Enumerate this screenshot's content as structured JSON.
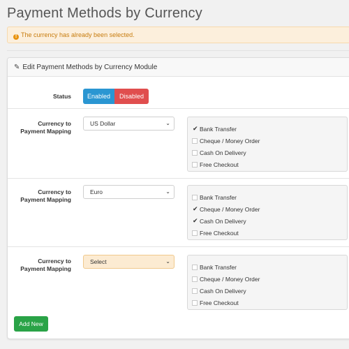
{
  "page": {
    "title": "Payment Methods by Currency"
  },
  "alert": {
    "icon": "exclamation-circle-icon",
    "message": "The currency has already been selected."
  },
  "panel": {
    "heading": "Edit Payment Methods by Currency Module",
    "heading_icon": "pencil-icon"
  },
  "status": {
    "label": "Status",
    "enabled_label": "Enabled",
    "disabled_label": "Disabled",
    "enabled_color": "#2a96d2",
    "disabled_color": "#e04e4e"
  },
  "mappings": [
    {
      "label_line1": "Currency to",
      "label_line2": "Payment Mapping",
      "currency": "US Dollar",
      "methods": [
        {
          "label": "Bank Transfer",
          "checked": true
        },
        {
          "label": "Cheque / Money Order",
          "checked": false
        },
        {
          "label": "Cash On Delivery",
          "checked": false
        },
        {
          "label": "Free Checkout",
          "checked": false
        }
      ]
    },
    {
      "label_line1": "Currency to",
      "label_line2": "Payment Mapping",
      "currency": "Euro",
      "methods": [
        {
          "label": "Bank Transfer",
          "checked": false
        },
        {
          "label": "Cheque / Money Order",
          "checked": true
        },
        {
          "label": "Cash On Delivery",
          "checked": true
        },
        {
          "label": "Free Checkout",
          "checked": false
        }
      ]
    },
    {
      "label_line1": "Currency to",
      "label_line2": "Payment Mapping",
      "currency": "Select",
      "methods": [
        {
          "label": "Bank Transfer",
          "checked": false
        },
        {
          "label": "Cheque / Money Order",
          "checked": false
        },
        {
          "label": "Cash On Delivery",
          "checked": false
        },
        {
          "label": "Free Checkout",
          "checked": false
        }
      ]
    }
  ],
  "add_button": {
    "label": "Add New",
    "color": "#2aa347"
  }
}
